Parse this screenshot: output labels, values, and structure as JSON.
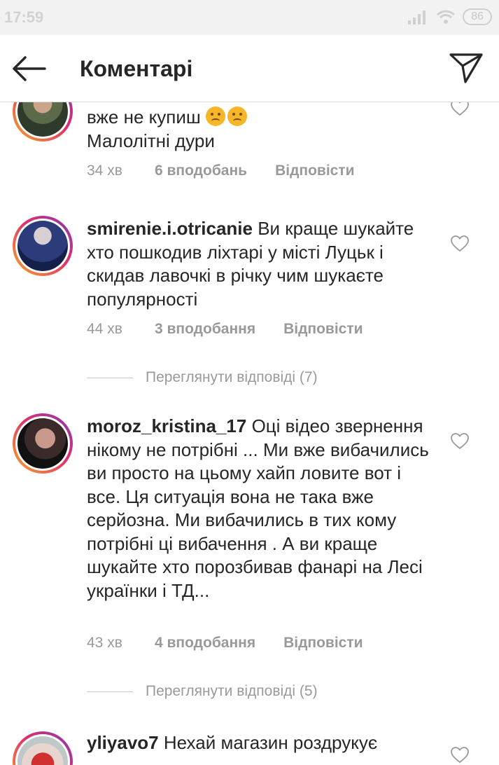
{
  "status_bar": {
    "time": "17:59",
    "battery": "86"
  },
  "header": {
    "title": "Коментарі"
  },
  "comments": [
    {
      "username": "",
      "text_line1": "вже не купиш",
      "text_line2": "Малолітні дури",
      "time": "34 хв",
      "likes": "6 вподобань",
      "reply": "Відповісти"
    },
    {
      "username": "smirenie.i.otricanie",
      "text": "Ви краще шукайте хто пошкодив ліхтарі у місті Луцьк і скидав лавочкі в річку чим шукаєте популярності",
      "time": "44 хв",
      "likes": "3 вподобання",
      "reply": "Відповісти",
      "view_replies": "Переглянути відповіді (7)"
    },
    {
      "username": "moroz_kristina_17",
      "text": "Оці відео звернення нікому не потрібні ... Ми вже вибачились ви просто на цьому хайп ловите вот і все. Ця ситуація вона не така вже серйозна. Ми вибачились в тих кому потрібні ці вибачення . А ви краще шукайте хто порозбивав фанарі на Лесі українки і ТД...",
      "time": "43 хв",
      "likes": "4 вподобання",
      "reply": "Відповісти",
      "view_replies": "Переглянути відповіді (5)"
    },
    {
      "username": "yliyavo7",
      "text": "Нехай магазин роздрукує"
    }
  ],
  "icons": {
    "back": "arrow-left-icon",
    "send": "paper-plane-icon",
    "like": "heart-outline-icon",
    "emoji": "frowning-face-icon"
  }
}
